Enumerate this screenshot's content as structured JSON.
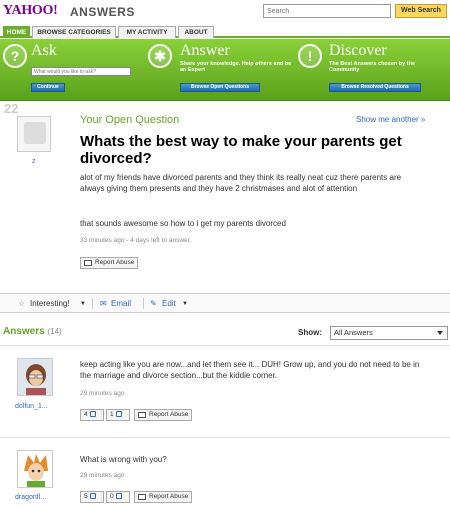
{
  "header": {
    "logo": "YAHOO!",
    "section": "ANSWERS",
    "search_placeholder": "Search",
    "search_button": "Web Search"
  },
  "nav": {
    "tabs": [
      {
        "label": "HOME"
      },
      {
        "label": "BROWSE CATEGORIES"
      },
      {
        "label": "MY ACTIVITY"
      },
      {
        "label": "ABOUT"
      }
    ]
  },
  "banner": {
    "ask": {
      "title": "Ask",
      "input_placeholder": "What would you like to ask?",
      "button": "Continue"
    },
    "answer": {
      "title": "Answer",
      "subtitle": "Share your knowledge. Help others and be an Expert",
      "button": "Browse Open Questions"
    },
    "discover": {
      "title": "Discover",
      "subtitle": "The Best Answers chosen by the Community",
      "button": "Browse Resolved Questions"
    }
  },
  "question": {
    "points": "22",
    "asker": "z",
    "section_label": "Your Open Question",
    "show_more": "Show me another »",
    "title": "Whats the best way to make your parents get divorced?",
    "body": "alot of my friends have divorced parents and they think its really neat cuz there parents are always giving them presents and they have 2 christmases and alot of attention",
    "body2": "that sounds awesome so how to i get my parents divorced",
    "time": "33 minutes ago - 4 days left to answer.",
    "report": "Report Abuse"
  },
  "actions": {
    "interesting": "Interesting!",
    "email": "Email",
    "edit": "Edit"
  },
  "answers": {
    "label": "Answers",
    "count": "(14)",
    "show_label": "Show:",
    "show_value": "All Answers",
    "items": [
      {
        "user": "dolfun_1...",
        "text": "keep acting like you are now...and let them see it... DUH! Grow up, and you do not need to be in the marriage and divorce section...but the kiddie corner.",
        "time": "29 minutes ago",
        "thumbs_up": "4",
        "thumbs_down": "1",
        "report": "Report Abuse"
      },
      {
        "user": "dragonfl...",
        "text": "What is wrong with you?",
        "time": "29 minutes ago",
        "thumbs_up": "5",
        "thumbs_down": "0",
        "report": "Report Abuse"
      }
    ]
  }
}
